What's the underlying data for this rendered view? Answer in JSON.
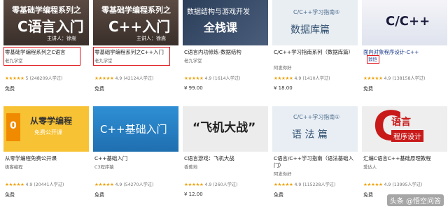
{
  "courses": [
    {
      "thumb_line1": "零基础学编程系列之",
      "thumb_line2": "C语言入门",
      "thumb_tag": "主讲人：徐嵩",
      "title": "零基础学编程系列之C语言",
      "author": "老九学堂",
      "rating": "5",
      "learners": "(248209人学过)",
      "price": "免费"
    },
    {
      "thumb_line1": "零基础学编程系列之",
      "thumb_line2": "C++入门",
      "thumb_tag": "主讲人：徐嵩",
      "title": "零基础学编程系列之C++入门",
      "author": "老九学堂",
      "rating": "4.9",
      "learners": "(42124人学过)",
      "price": "免费"
    },
    {
      "thumb_line1": "数据结构与游戏开发",
      "thumb_line2": "全栈课",
      "thumb_tag": "",
      "title": "C语言内功修炼-数据结构",
      "author": "老九学堂",
      "rating": "4.9",
      "learners": "(1614人学过)",
      "price": "¥ 99.00"
    },
    {
      "thumb_line1": "C/C++学习指南⑤",
      "thumb_line2": "数据库篇",
      "thumb_tag": "",
      "title": "C/C++学习指南系列（数据库篇）",
      "author": "阿发你好",
      "rating": "4.9",
      "learners": "(1410人学过)",
      "price": "¥ 18.00"
    },
    {
      "thumb_line1": "C/C++",
      "thumb_line2": "",
      "thumb_tag": "",
      "title": "面向对象程序设计-C++",
      "author": "翁恺",
      "rating": "4.9",
      "learners": "(138158人学过)",
      "price": "免费"
    },
    {
      "thumb_line1": "从零学编程",
      "thumb_line2": "免费公开课",
      "thumb_tag": "0",
      "title": "从零学编程免费公开课",
      "author": "极客编程",
      "rating": "4.9",
      "learners": "(20441人学过)",
      "price": "免费"
    },
    {
      "thumb_line1": "C++基础入门",
      "thumb_line2": "",
      "thumb_tag": "",
      "title": "C++基础入门",
      "author": "C3程序猿",
      "rating": "4.9",
      "learners": "(54270人学过)",
      "price": "免费"
    },
    {
      "thumb_line1": "“飞机大战”",
      "thumb_line2": "",
      "thumb_tag": "",
      "title": "C语言游戏：飞机大战",
      "author": "香蕉地",
      "rating": "4.9",
      "learners": "(260人学过)",
      "price": "¥ 12.00"
    },
    {
      "thumb_line1": "C/C++学习指南①",
      "thumb_line2": "语 法 篇",
      "thumb_tag": "",
      "title": "C语言/C++学习指南（语法基础入门）",
      "author": "阿发你好",
      "rating": "4.9",
      "learners": "(115228人学过)",
      "price": "免费"
    },
    {
      "thumb_line1": "C",
      "thumb_line2": "语言",
      "thumb_tag": "程序设计",
      "title": "汇编C语言C++基础原理教程",
      "author": "爱达人",
      "rating": "4.9",
      "learners": "(13995人学过)",
      "price": "免费"
    }
  ],
  "watermark": "头条 @悟空问答",
  "colors": {
    "accent": "#e0141a",
    "star": "#f0a000"
  }
}
